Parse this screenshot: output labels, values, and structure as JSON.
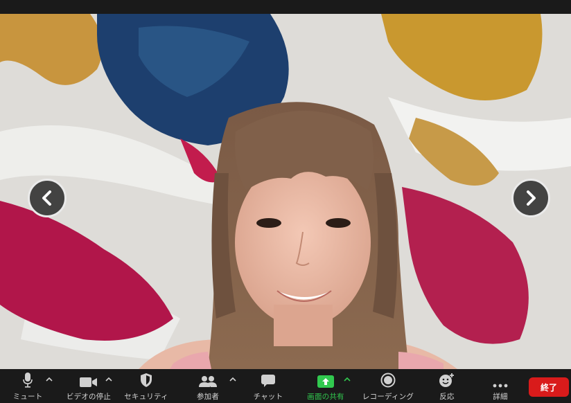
{
  "toolbar": {
    "mute": "ミュート",
    "stop_video": "ビデオの停止",
    "security": "セキュリティ",
    "participants": "参加者",
    "chat": "チャット",
    "share_screen": "画面の共有",
    "recording": "レコーディング",
    "reactions": "反応",
    "more": "詳細",
    "end": "終了"
  },
  "colors": {
    "toolbar_bg": "#1a1a1a",
    "share_green": "#31c94f",
    "end_red": "#d91b1b"
  },
  "icons": [
    "microphone-icon",
    "video-camera-icon",
    "shield-icon",
    "participants-icon",
    "chat-bubble-icon",
    "share-screen-icon",
    "record-icon",
    "reaction-icon",
    "more-dots-icon",
    "chevron-left-icon",
    "chevron-right-icon"
  ]
}
